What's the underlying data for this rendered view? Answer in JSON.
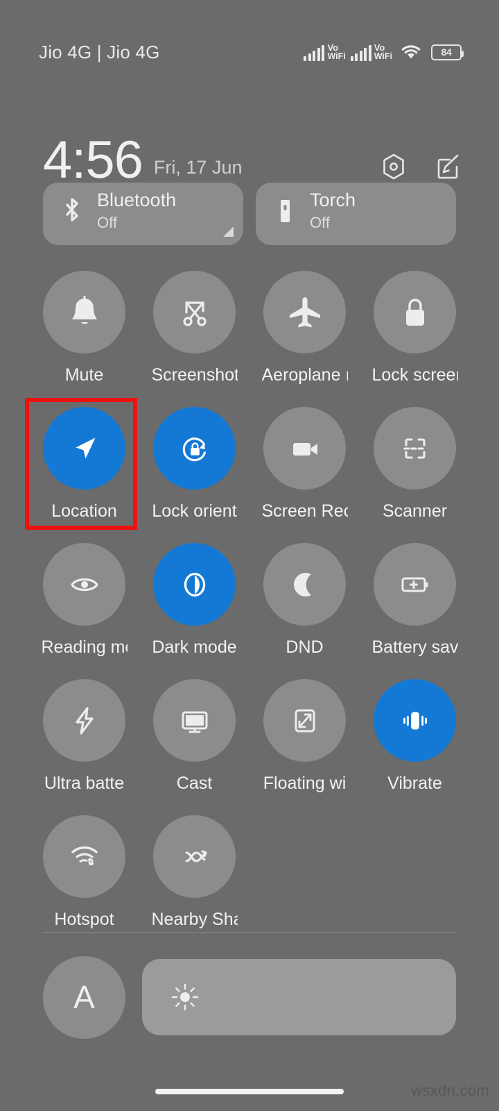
{
  "status_bar": {
    "carrier": "Jio 4G | Jio 4G",
    "network1_label_top": "Vo",
    "network1_label_bottom": "WiFi",
    "network2_label_top": "Vo",
    "network2_label_bottom": "WiFi",
    "wifi_icon": "wifi-icon",
    "battery_percent": "84"
  },
  "header": {
    "time": "4:56",
    "date": "Fri, 17 Jun",
    "settings_icon": "settings-gear-icon",
    "edit_icon": "edit-pencil-icon"
  },
  "big_tiles": [
    {
      "title": "Bluetooth",
      "status": "Off",
      "icon": "bluetooth-icon",
      "active": false,
      "has_expand": true
    },
    {
      "title": "Torch",
      "status": "Off",
      "icon": "torch-icon",
      "active": false,
      "has_expand": false
    }
  ],
  "tiles": [
    {
      "label": "Mute",
      "icon": "bell-icon",
      "active": false
    },
    {
      "label": "Screenshot",
      "icon": "scissors-icon",
      "active": false
    },
    {
      "label": "Aeroplane ı",
      "icon": "aeroplane-icon",
      "active": false
    },
    {
      "label": "Lock screeı",
      "icon": "padlock-icon",
      "active": false
    },
    {
      "label": "Location",
      "icon": "location-arrow-icon",
      "active": true
    },
    {
      "label": "Lock orient",
      "icon": "rotation-lock-icon",
      "active": true
    },
    {
      "label": "Screen Rec",
      "icon": "video-camera-icon",
      "active": false
    },
    {
      "label": "Scanner",
      "icon": "scan-frame-icon",
      "active": false
    },
    {
      "label": "Reading mo",
      "icon": "eye-icon",
      "active": false
    },
    {
      "label": "Dark mode",
      "icon": "contrast-circle-icon",
      "active": true
    },
    {
      "label": "DND",
      "icon": "moon-icon",
      "active": false
    },
    {
      "label": "Battery sav",
      "icon": "battery-plus-icon",
      "active": false
    },
    {
      "label": "Ultra batte",
      "icon": "lightning-bolt-icon",
      "active": false
    },
    {
      "label": "Cast",
      "icon": "monitor-icon",
      "active": false
    },
    {
      "label": "Floating wi",
      "icon": "floating-window-icon",
      "active": false
    },
    {
      "label": "Vibrate",
      "icon": "vibrate-icon",
      "active": true
    },
    {
      "label": "Hotspot",
      "icon": "hotspot-icon",
      "active": false
    },
    {
      "label": "Nearby Sha",
      "icon": "nearby-share-icon",
      "active": false
    }
  ],
  "brightness": {
    "auto_label": "A",
    "slider_icon": "brightness-sun-icon",
    "fill_percent": 0
  },
  "annotation": {
    "highlight_target": "Location",
    "highlight_color": "#ee1111"
  },
  "watermark": {
    "text": "wsxdn.com"
  },
  "colors": {
    "background": "#6b6b6b",
    "tile_inactive": "#8c8c8c",
    "tile_active": "#1479d4",
    "text_primary": "#f2f2f2",
    "text_secondary": "#cfcfcf"
  }
}
